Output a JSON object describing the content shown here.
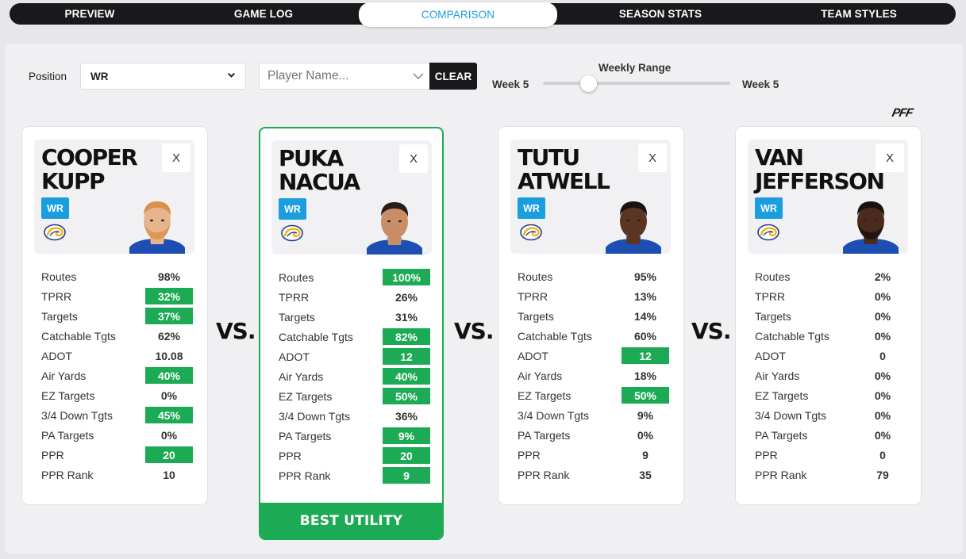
{
  "nav": {
    "tabs": [
      {
        "label": "PREVIEW"
      },
      {
        "label": "GAME LOG"
      },
      {
        "label": "COMPARISON"
      },
      {
        "label": "SEASON STATS"
      },
      {
        "label": "TEAM STYLES"
      }
    ],
    "active_index": 2
  },
  "filters": {
    "position_label": "Position",
    "position_value": "WR",
    "player_placeholder": "Player Name...",
    "clear_label": "CLEAR",
    "range_label": "Weekly Range",
    "range_start": "Week 5",
    "range_end": "Week 5"
  },
  "brand": {
    "logo_text": "PFF"
  },
  "vs_label": "VS.",
  "best_label": "BEST UTILITY",
  "colors": {
    "accent": "#1a9ee0",
    "highlight": "#1daa55",
    "dark": "#18191b"
  },
  "stat_labels": [
    "Routes",
    "TPRR",
    "Targets",
    "Catchable Tgts",
    "ADOT",
    "Air Yards",
    "EZ Targets",
    "3/4 Down Tgts",
    "PA Targets",
    "PPR",
    "PPR Rank"
  ],
  "players": [
    {
      "first": "COOPER",
      "last": "KUPP",
      "position": "WR",
      "close": "X",
      "team_icon": "rams-logo-icon",
      "values": [
        "98%",
        "32%",
        "37%",
        "62%",
        "10.08",
        "40%",
        "0%",
        "45%",
        "0%",
        "20",
        "10"
      ],
      "highlight": [
        false,
        true,
        true,
        false,
        false,
        true,
        false,
        true,
        false,
        true,
        false
      ]
    },
    {
      "first": "PUKA",
      "last": "NACUA",
      "position": "WR",
      "close": "X",
      "team_icon": "rams-logo-icon",
      "values": [
        "100%",
        "26%",
        "31%",
        "82%",
        "12",
        "40%",
        "50%",
        "36%",
        "9%",
        "20",
        "9"
      ],
      "highlight": [
        true,
        false,
        false,
        true,
        true,
        true,
        true,
        false,
        true,
        true,
        true
      ]
    },
    {
      "first": "TUTU",
      "last": "ATWELL",
      "position": "WR",
      "close": "X",
      "team_icon": "rams-logo-icon",
      "values": [
        "95%",
        "13%",
        "14%",
        "60%",
        "12",
        "18%",
        "50%",
        "9%",
        "0%",
        "9",
        "35"
      ],
      "highlight": [
        false,
        false,
        false,
        false,
        true,
        false,
        true,
        false,
        false,
        false,
        false
      ]
    },
    {
      "first": "VAN",
      "last": "JEFFERSON",
      "position": "WR",
      "close": "X",
      "team_icon": "rams-logo-icon",
      "values": [
        "2%",
        "0%",
        "0%",
        "0%",
        "0",
        "0%",
        "0%",
        "0%",
        "0%",
        "0",
        "79"
      ],
      "highlight": [
        false,
        false,
        false,
        false,
        false,
        false,
        false,
        false,
        false,
        false,
        false
      ]
    }
  ]
}
